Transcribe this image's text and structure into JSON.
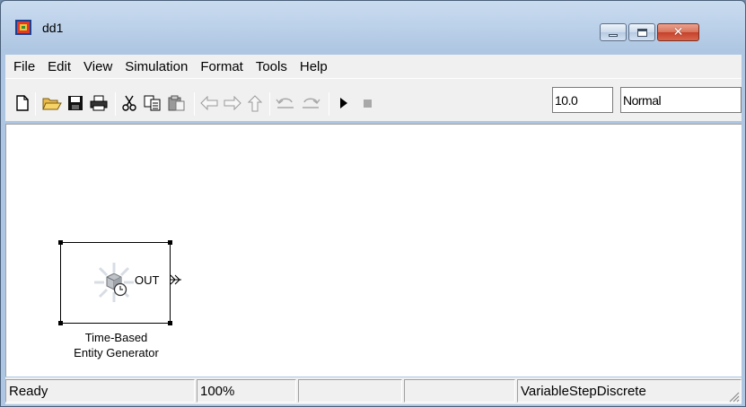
{
  "window": {
    "title": "dd1",
    "icon": "simulink-model-icon",
    "controls": [
      "minimize-icon",
      "maximize-icon",
      "close-icon"
    ]
  },
  "menu": [
    "File",
    "Edit",
    "View",
    "Simulation",
    "Format",
    "Tools",
    "Help"
  ],
  "toolbar": {
    "buttons": [
      "new-model-icon",
      "open-icon",
      "save-icon",
      "print-icon",
      "cut-icon",
      "copy-icon",
      "paste-icon",
      "back-icon",
      "forward-icon",
      "up-icon",
      "undo-icon",
      "redo-icon",
      "start-simulation-icon",
      "stop-simulation-icon"
    ],
    "stop_time": "10.0",
    "simulation_mode": "Normal"
  },
  "canvas": {
    "block": {
      "label_line1": "Time-Based",
      "label_line2": "Entity Generator",
      "port_label": "OUT",
      "icon": "entity-generator-icon"
    }
  },
  "status": {
    "state": "Ready",
    "zoom": "100%",
    "cell3": "",
    "cell4": "",
    "solver": "VariableStepDiscrete"
  },
  "colors": {
    "titlebar": "#bcd1ea",
    "close_button": "#c5412a",
    "panel": "#f0f0f0",
    "canvas": "#ffffff"
  }
}
